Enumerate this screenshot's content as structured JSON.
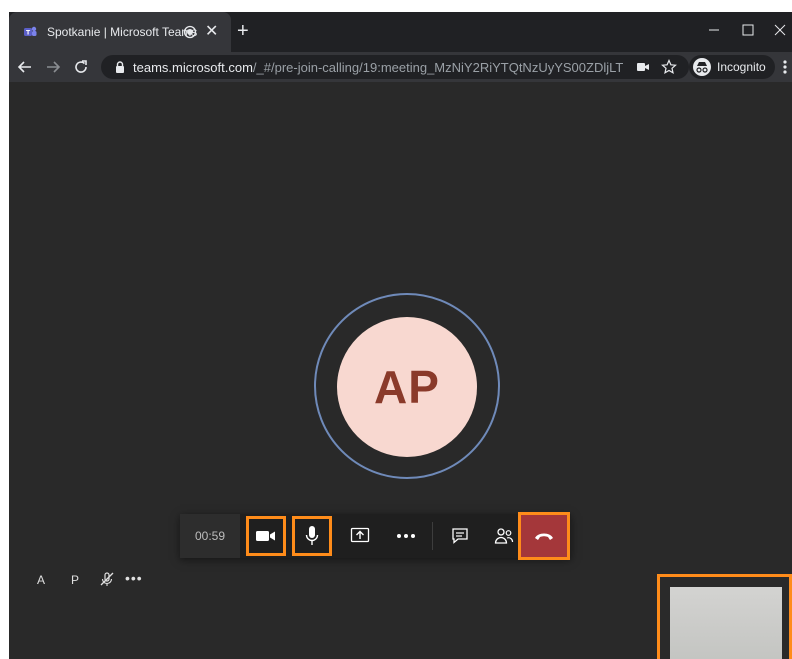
{
  "browser": {
    "tab": {
      "title": "Spotkanie | Microsoft Teams",
      "favicon": "teams-icon",
      "recording_indicator": "recording-icon"
    },
    "new_tab_label": "+",
    "address_bar": {
      "host": "teams.microsoft.com",
      "path": "/_#/pre-join-calling/19:meeting_MzNiY2RiYTQtNzUyYS00ZDljLTk..."
    },
    "incognito_label": "Incognito"
  },
  "meeting": {
    "avatar_initials": "AP",
    "timer": "00:59",
    "controls": {
      "camera": "video-camera-icon",
      "mic": "microphone-icon",
      "share": "share-screen-icon",
      "more": "more-actions-icon",
      "chat": "chat-icon",
      "people": "participants-icon",
      "hangup": "hang-up-icon"
    },
    "participant": {
      "initial_first": "A",
      "initial_last": "P",
      "more": "•••"
    }
  },
  "colors": {
    "stage_bg": "#292929",
    "hangup": "#a4373a",
    "highlight": "#ff8c1a",
    "avatar_bg": "#f8d8d0",
    "avatar_text": "#8a3a2a",
    "ring": "#6f8ab9"
  }
}
